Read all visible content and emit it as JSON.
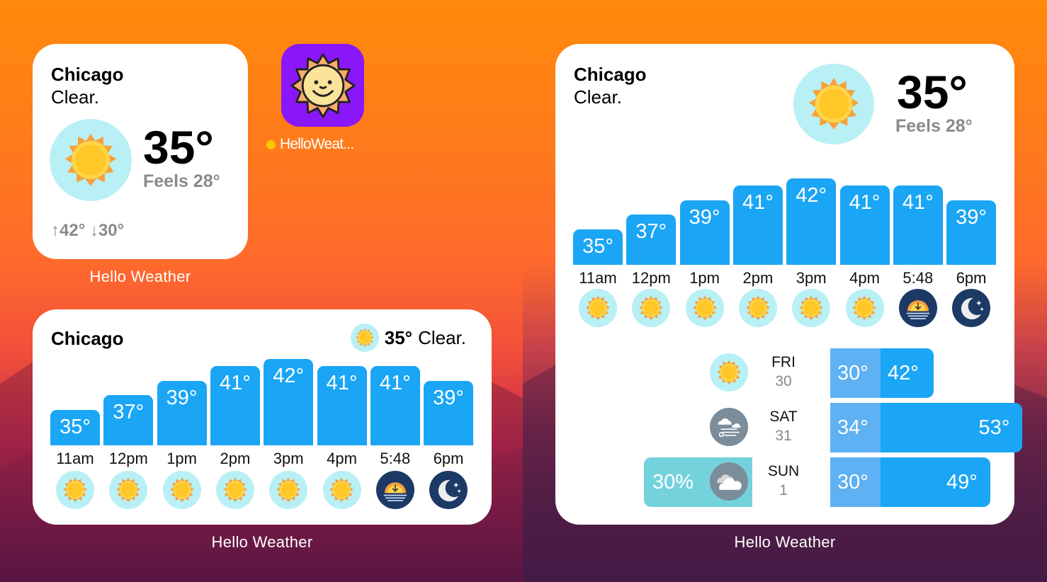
{
  "app": {
    "icon_label": "HelloWeat...",
    "widget_label": "Hello Weather"
  },
  "current": {
    "city": "Chicago",
    "condition": "Clear.",
    "temp": "35°",
    "feels": "Feels 28°",
    "high_low": "↑42° ↓30°",
    "inline_temp": "35°",
    "inline_condition": "Clear."
  },
  "hourly": [
    {
      "label": "11am",
      "temp": "35°",
      "value": 35,
      "icon": "sun-icon"
    },
    {
      "label": "12pm",
      "temp": "37°",
      "value": 37,
      "icon": "sun-icon"
    },
    {
      "label": "1pm",
      "temp": "39°",
      "value": 39,
      "icon": "sun-icon"
    },
    {
      "label": "2pm",
      "temp": "41°",
      "value": 41,
      "icon": "sun-icon"
    },
    {
      "label": "3pm",
      "temp": "42°",
      "value": 42,
      "icon": "sun-icon"
    },
    {
      "label": "4pm",
      "temp": "41°",
      "value": 41,
      "icon": "sun-icon"
    },
    {
      "label": "5:48",
      "temp": "41°",
      "value": 41,
      "icon": "sunset-icon"
    },
    {
      "label": "6pm",
      "temp": "39°",
      "value": 39,
      "icon": "moon-icon"
    }
  ],
  "daily": [
    {
      "day": "FRI",
      "date": "30",
      "low": "30°",
      "high": "42°",
      "low_value": 30,
      "high_value": 42,
      "icon": "sun-icon",
      "precip": ""
    },
    {
      "day": "SAT",
      "date": "31",
      "low": "34°",
      "high": "53°",
      "low_value": 34,
      "high_value": 53,
      "icon": "wind-cloud-icon",
      "precip": ""
    },
    {
      "day": "SUN",
      "date": "1",
      "low": "30°",
      "high": "49°",
      "low_value": 30,
      "high_value": 49,
      "icon": "cloud-icon",
      "precip": "30%",
      "precip_value": 30
    }
  ],
  "colors": {
    "bar": "#1ba5f5",
    "bar_low": "#5eb1f2",
    "precip": "#74d2dd",
    "sun_bg": "#b8f0f5",
    "night_bg": "#1d3a66",
    "app_icon_bg": "#8a17f7"
  }
}
